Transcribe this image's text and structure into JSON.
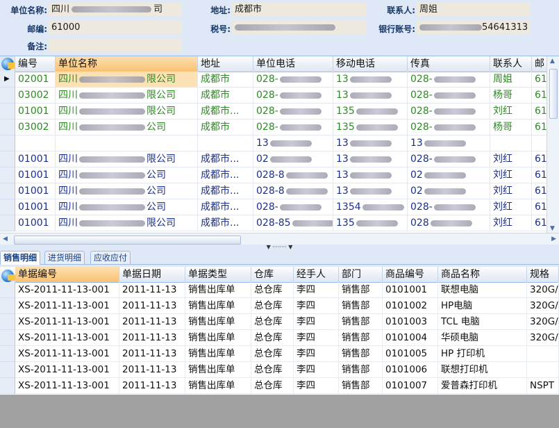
{
  "form": {
    "company_label": "单位名称:",
    "company_value": "四川",
    "company_value_tail": "司",
    "address_label": "地址:",
    "address_value": "成都市",
    "contact_label": "联系人:",
    "contact_value": "周姐",
    "postcode_label": "邮编:",
    "postcode_value": "61000",
    "tax_label": "税号:",
    "bank_label": "银行账号:",
    "bank_value_tail": "54641313",
    "remark_label": "备注:"
  },
  "upper_grid": {
    "columns": [
      "编号",
      "单位名称",
      "地址",
      "单位电话",
      "移动电话",
      "传真",
      "联系人",
      "邮"
    ],
    "rows": [
      {
        "code": "02001",
        "name": "四川",
        "name_tail": "限公司",
        "addr": "成都市",
        "tel": "028-",
        "mobile": "13",
        "fax": "028-",
        "contact": "周姐",
        "post": "61",
        "color": "green",
        "selected": true
      },
      {
        "code": "03002",
        "name": "四川",
        "name_tail": "限公司",
        "addr": "成都市",
        "tel": "028-",
        "mobile": "13",
        "fax": "028-",
        "contact": "杨哥",
        "post": "61",
        "color": "green"
      },
      {
        "code": "01001",
        "name": "四川",
        "name_tail": "限公司",
        "addr": "成都市...",
        "tel": "028-",
        "mobile": "135",
        "fax": "028-",
        "contact": "刘红",
        "post": "61",
        "color": "green"
      },
      {
        "code": "03002",
        "name": "四川",
        "name_tail": "公司",
        "addr": "成都市",
        "tel": "028-",
        "mobile": "135",
        "fax": "028-",
        "contact": "杨哥",
        "post": "61",
        "color": "green"
      },
      {
        "code": "",
        "name": "",
        "name_tail": "",
        "addr": "",
        "tel": "13",
        "mobile": "13",
        "fax": "13",
        "contact": "",
        "post": "",
        "color": "blue"
      },
      {
        "code": "01001",
        "name": "四川",
        "name_tail": "限公司",
        "addr": "成都市...",
        "tel": "02",
        "mobile": "13",
        "fax": "028-",
        "contact": "刘红",
        "post": "61",
        "color": "blue"
      },
      {
        "code": "01001",
        "name": "四川",
        "name_tail": "公司",
        "addr": "成都市...",
        "tel": "028-8",
        "mobile": "13",
        "fax": "02",
        "contact": "刘红",
        "post": "61",
        "color": "blue"
      },
      {
        "code": "01001",
        "name": "四川",
        "name_tail": "公司",
        "addr": "成都市...",
        "tel": "028-8",
        "mobile": "13",
        "fax": "02",
        "contact": "刘红",
        "post": "61",
        "color": "blue"
      },
      {
        "code": "01001",
        "name": "四川",
        "name_tail": "公司",
        "addr": "成都市...",
        "tel": "028-",
        "mobile": "1354",
        "fax": "028-",
        "contact": "刘红",
        "post": "61",
        "color": "blue"
      },
      {
        "code": "01001",
        "name": "四川",
        "name_tail": "限公司",
        "addr": "成都市...",
        "tel": "028-85",
        "mobile": "135",
        "fax": "028",
        "contact": "刘红",
        "post": "61",
        "color": "blue"
      }
    ]
  },
  "tabs": [
    "销售明细",
    "进货明细",
    "应收应付"
  ],
  "lower_grid": {
    "columns": [
      "单据编号",
      "单据日期",
      "单据类型",
      "仓库",
      "经手人",
      "部门",
      "商品编号",
      "商品名称",
      "规格"
    ],
    "rows": [
      [
        "XS-2011-11-13-001",
        "2011-11-13",
        "销售出库单",
        "总仓库",
        "李四",
        "销售部",
        "0101001",
        "联想电脑",
        "320G/"
      ],
      [
        "XS-2011-11-13-001",
        "2011-11-13",
        "销售出库单",
        "总仓库",
        "李四",
        "销售部",
        "0101002",
        "HP电脑",
        "320G/"
      ],
      [
        "XS-2011-11-13-001",
        "2011-11-13",
        "销售出库单",
        "总仓库",
        "李四",
        "销售部",
        "0101003",
        "TCL 电脑",
        "320G/"
      ],
      [
        "XS-2011-11-13-001",
        "2011-11-13",
        "销售出库单",
        "总仓库",
        "李四",
        "销售部",
        "0101004",
        "华硕电脑",
        "320G/"
      ],
      [
        "XS-2011-11-13-001",
        "2011-11-13",
        "销售出库单",
        "总仓库",
        "李四",
        "销售部",
        "0101005",
        "HP 打印机",
        ""
      ],
      [
        "XS-2011-11-13-001",
        "2011-11-13",
        "销售出库单",
        "总仓库",
        "李四",
        "销售部",
        "0101006",
        "联想打印机",
        ""
      ],
      [
        "XS-2011-11-13-001",
        "2011-11-13",
        "销售出库单",
        "总仓库",
        "李四",
        "销售部",
        "0101007",
        "爱普森打印机",
        "NSPT"
      ]
    ]
  }
}
